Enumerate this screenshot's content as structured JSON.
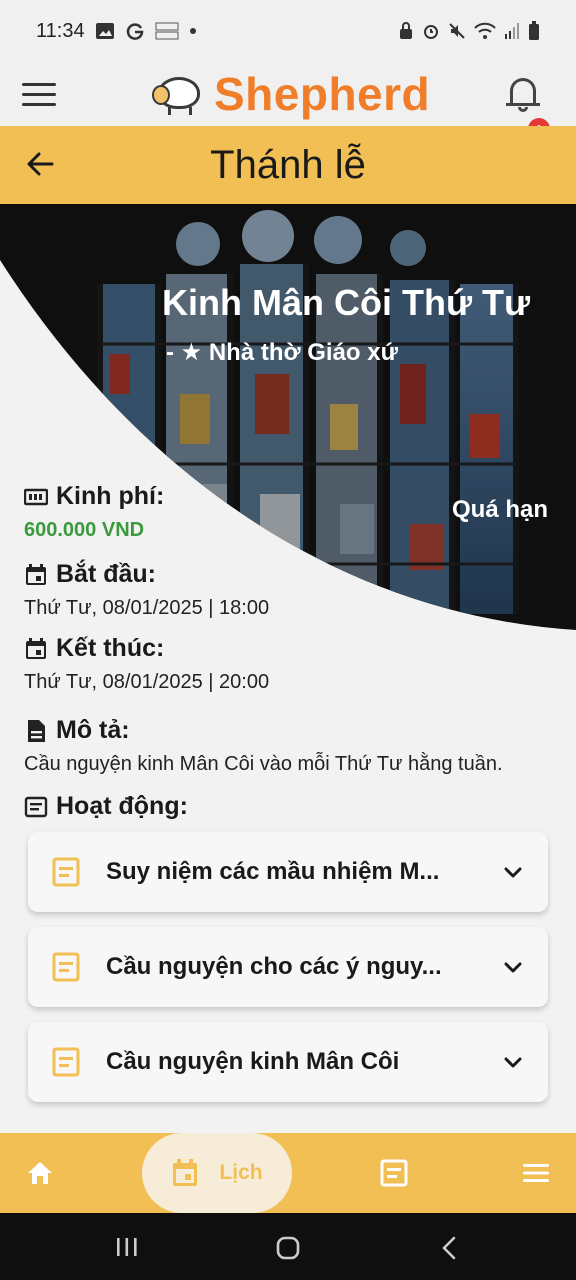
{
  "status_bar": {
    "time": "11:34",
    "indicators": [
      "image-icon",
      "g-icon",
      "zalopay-icon",
      "dot-icon"
    ],
    "right_icons": [
      "lock-icon",
      "alarm-icon",
      "mute-icon",
      "wifi-icon",
      "signal-icon",
      "battery-icon"
    ]
  },
  "header": {
    "brand": "Shepherd",
    "notification_count": "1"
  },
  "page": {
    "title": "Thánh lễ"
  },
  "event": {
    "title": "Kinh Mân Côi Thứ Tư",
    "location": "- ★ Nhà thờ Giáo xứ",
    "status": "Quá hạn"
  },
  "info": {
    "cost_label": "Kinh phí:",
    "cost_value": "600.000 VND",
    "start_label": "Bắt đầu:",
    "start_value": "Thứ Tư, 08/01/2025 | 18:00",
    "end_label": "Kết thúc:",
    "end_value": "Thứ Tư, 08/01/2025 | 20:00",
    "desc_label": "Mô tả:",
    "desc_value": "Cầu nguyện kinh Mân Côi vào mỗi Thứ Tư hằng tuần.",
    "activities_label": "Hoạt động:"
  },
  "activities": [
    {
      "label": "Suy niệm các mầu nhiệm M..."
    },
    {
      "label": "Cầu nguyện cho các ý nguy..."
    },
    {
      "label": "Cầu nguyện kinh Mân Côi"
    }
  ],
  "bottom_nav": {
    "active_label": "Lịch"
  },
  "colors": {
    "accent": "#f2bf55",
    "brand": "#f07d2a",
    "money": "#3b9a3d",
    "badge": "#e53935"
  }
}
